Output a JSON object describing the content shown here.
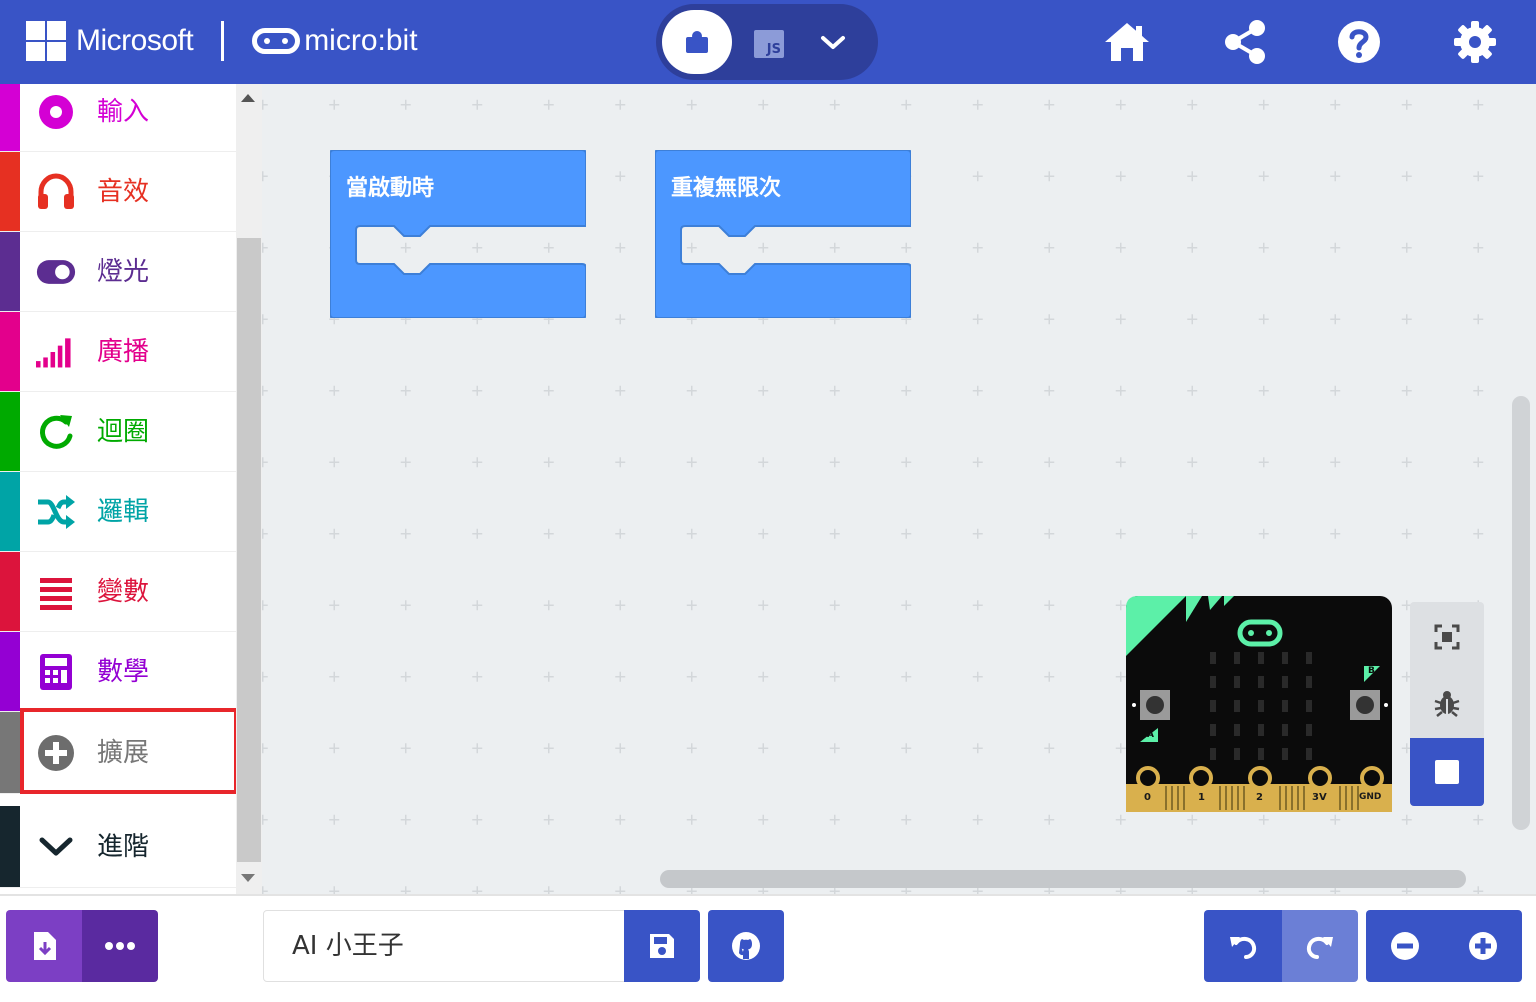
{
  "header": {
    "brand_microsoft": "Microsoft",
    "brand_microbit": "micro:bit",
    "toggle_js_label": "JS",
    "icons": [
      "home-icon",
      "share-icon",
      "help-icon",
      "settings-icon"
    ],
    "color": "#3954c6"
  },
  "toolbox": {
    "categories": [
      {
        "label": "輸入",
        "color": "#d400d4",
        "icon": "input-icon"
      },
      {
        "label": "音效",
        "color": "#e63022",
        "icon": "headphones-icon"
      },
      {
        "label": "燈光",
        "color": "#5c2d91",
        "icon": "toggle-icon"
      },
      {
        "label": "廣播",
        "color": "#e3008c",
        "icon": "radio-signal-icon"
      },
      {
        "label": "迴圈",
        "color": "#00aa00",
        "icon": "loop-icon"
      },
      {
        "label": "邏輯",
        "color": "#00a4a6",
        "icon": "shuffle-icon"
      },
      {
        "label": "變數",
        "color": "#dc143c",
        "icon": "list-icon"
      },
      {
        "label": "數學",
        "color": "#9400d3",
        "icon": "calculator-icon"
      },
      {
        "label": "擴展",
        "color": "#777777",
        "icon": "plus-circle-icon"
      },
      {
        "label": "進階",
        "color": "#16262e",
        "icon": "chevron-down-icon"
      }
    ]
  },
  "workspace": {
    "blocks": [
      {
        "label": "當啟動時"
      },
      {
        "label": "重複無限次"
      }
    ],
    "simulator": {
      "pins": [
        "0",
        "1",
        "2",
        "3V",
        "GND"
      ],
      "button_a": "A",
      "button_b": "B"
    }
  },
  "bottombar": {
    "project_name": "AI 小王子",
    "icons": [
      "download-icon",
      "more-icon",
      "save-icon",
      "github-icon",
      "undo-icon",
      "redo-icon",
      "zoom-out-icon",
      "zoom-in-icon"
    ]
  }
}
